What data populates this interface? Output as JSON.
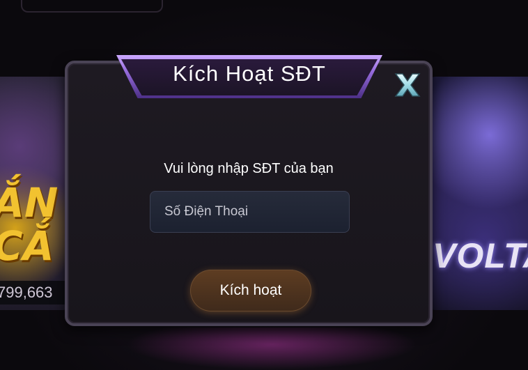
{
  "background": {
    "left_tile_letters": "ẮN\nCẮ",
    "left_tile_jackpot": "799,663",
    "right_tile_brand": "VOLTA"
  },
  "dialog": {
    "title": "Kích Hoạt SĐT",
    "close_label": "X",
    "prompt": "Vui lòng nhập SĐT của bạn",
    "phone_input": {
      "value": "",
      "placeholder": "Số Điện Thoại"
    },
    "activate_label": "Kích hoạt"
  },
  "colors": {
    "title_tab_accent": "#9a6fe0",
    "close_icon": "#bfeef5",
    "button_bg": "#4f3420",
    "input_bg": "#222737"
  },
  "icons": {
    "close": "close-icon"
  }
}
